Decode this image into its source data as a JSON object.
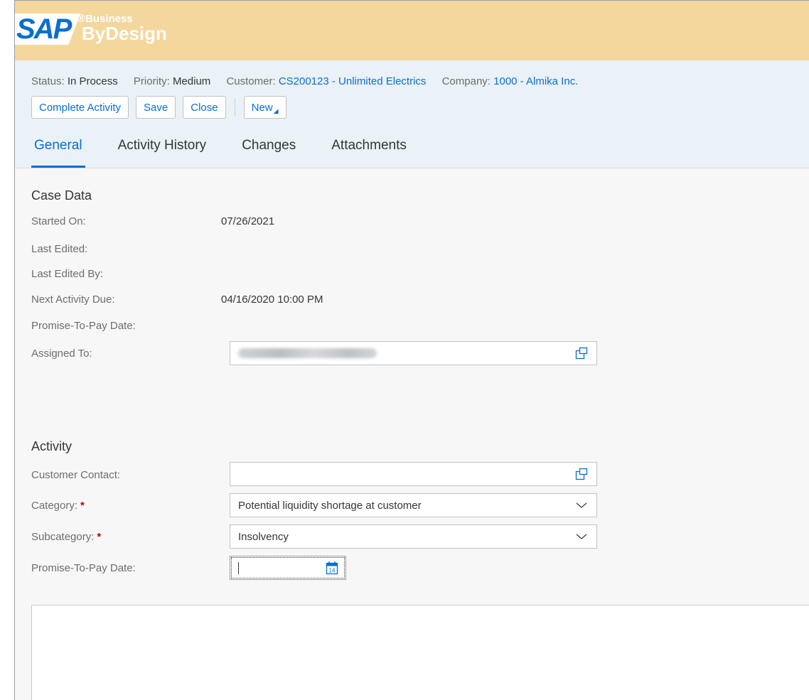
{
  "brand": {
    "sap": "SAP",
    "registered": "®",
    "business": "Business",
    "bydesign": "ByDesign"
  },
  "status_line": {
    "status_label": "Status:",
    "status_value": "In Process",
    "priority_label": "Priority:",
    "priority_value": "Medium",
    "customer_label": "Customer:",
    "customer_value": "CS200123 - Unlimited Electrics",
    "company_label": "Company:",
    "company_value": "1000 - Almika Inc."
  },
  "toolbar": {
    "complete_label": "Complete Activity",
    "save_label": "Save",
    "close_label": "Close",
    "new_label": "New"
  },
  "tabs": [
    {
      "label": "General",
      "active": true
    },
    {
      "label": "Activity History",
      "active": false
    },
    {
      "label": "Changes",
      "active": false
    },
    {
      "label": "Attachments",
      "active": false
    }
  ],
  "case_data": {
    "title": "Case Data",
    "started_on_label": "Started On:",
    "started_on_value": "07/26/2021",
    "last_edited_label": "Last Edited:",
    "last_edited_by_label": "Last Edited By:",
    "next_activity_label": "Next Activity Due:",
    "next_activity_value": "04/16/2020 10:00 PM",
    "promise_label": "Promise-To-Pay Date:",
    "assigned_label": "Assigned To:"
  },
  "activity": {
    "title": "Activity",
    "contact_label": "Customer Contact:",
    "contact_value": "",
    "category_label": "Category:",
    "category_value": "Potential liquidity shortage at customer",
    "subcategory_label": "Subcategory:",
    "subcategory_value": "Insolvency",
    "promise_label": "Promise-To-Pay Date:",
    "promise_value": "",
    "required_mark": "*",
    "calendar_day": "14"
  },
  "colors": {
    "brand_bar": "#f4d79c",
    "info_bar": "#eaf1f7",
    "link": "#0a6ed1",
    "required": "#bb0000"
  },
  "icons": {
    "value_help": "value-help-icon",
    "dropdown": "chevron-down-icon",
    "calendar": "calendar-icon"
  }
}
